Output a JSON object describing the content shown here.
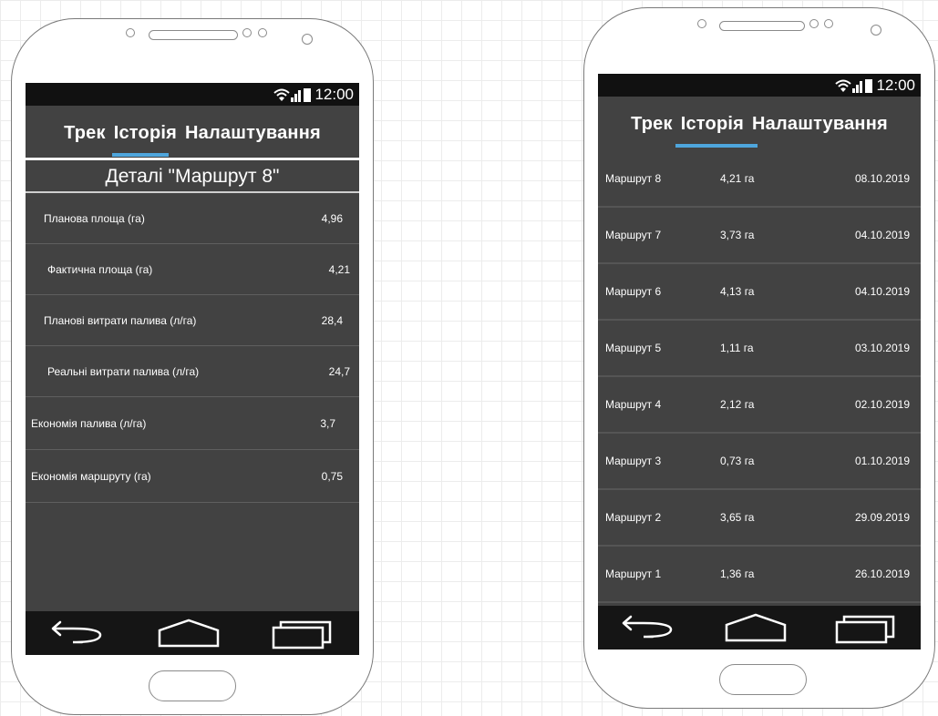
{
  "status_bar": {
    "time": "12:00"
  },
  "tabs": [
    "Трек",
    "Історія",
    "Налаштування"
  ],
  "detail_screen": {
    "title": "Деталі \"Маршрут 8\"",
    "rows": [
      {
        "label": "Планова площа (га)",
        "value": "4,96"
      },
      {
        "label": "Фактична площа (га)",
        "value": "4,21"
      },
      {
        "label": "Планові витрати палива (л/га)",
        "value": "28,4"
      },
      {
        "label": "Реальні витрати палива  (л/га)",
        "value": "24,7"
      },
      {
        "label": "Економія палива  (л/га)",
        "value": "3,7"
      },
      {
        "label": "Економія маршруту (га)",
        "value": "0,75"
      }
    ]
  },
  "history_screen": {
    "active_tab": "Історія",
    "routes": [
      {
        "name": "Маршрут 8",
        "area": "4,21 га",
        "date": "08.10.2019"
      },
      {
        "name": "Маршрут 7",
        "area": "3,73 га",
        "date": "04.10.2019"
      },
      {
        "name": "Маршрут 6",
        "area": "4,13 га",
        "date": "04.10.2019"
      },
      {
        "name": "Маршрут 5",
        "area": "1,11 га",
        "date": "03.10.2019"
      },
      {
        "name": "Маршрут 4",
        "area": "2,12 га",
        "date": "02.10.2019"
      },
      {
        "name": "Маршрут 3",
        "area": "0,73 га",
        "date": "01.10.2019"
      },
      {
        "name": "Маршрут 2",
        "area": "3,65 га",
        "date": "29.09.2019"
      },
      {
        "name": "Маршрут 1",
        "area": "1,36 га",
        "date": "26.10.2019"
      }
    ]
  },
  "nav_icons": [
    "back-icon",
    "home-icon",
    "recent-apps-icon"
  ],
  "colors": {
    "screen_bg": "#424242",
    "status_bg": "#111111",
    "tab_indicator": "#4ea6dd",
    "nav_bg": "#151515"
  }
}
